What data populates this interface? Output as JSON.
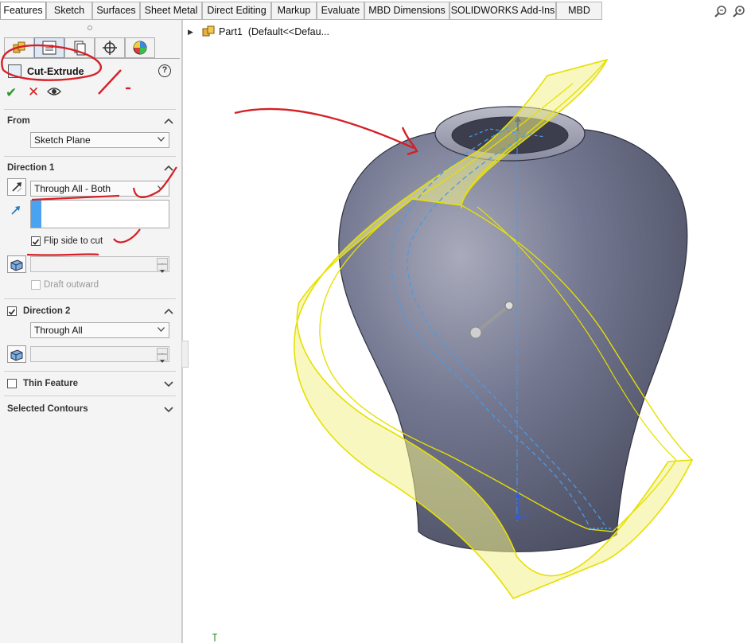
{
  "tabs": [
    {
      "label": "Features",
      "active": true
    },
    {
      "label": "Sketch"
    },
    {
      "label": "Surfaces"
    },
    {
      "label": "Sheet Metal"
    },
    {
      "label": "Direct Editing"
    },
    {
      "label": "Markup"
    },
    {
      "label": "Evaluate"
    },
    {
      "label": "MBD Dimensions"
    },
    {
      "label": "SOLIDWORKS Add-Ins"
    },
    {
      "label": "MBD"
    }
  ],
  "property_manager": {
    "title": "Cut-Extrude",
    "help_symbol": "?",
    "ok_symbol": "✔",
    "cancel_symbol": "✕",
    "from": {
      "label": "From",
      "value": "Sketch Plane"
    },
    "direction1": {
      "label": "Direction 1",
      "end_condition": "Through All - Both",
      "flip_side_label": "Flip side to cut",
      "flip_side_checked": true,
      "draft_outward_label": "Draft outward",
      "draft_outward_checked": false
    },
    "direction2": {
      "label": "Direction 2",
      "checked": true,
      "end_condition": "Through All"
    },
    "thin_feature": {
      "label": "Thin Feature",
      "checked": false
    },
    "selected_contours": {
      "label": "Selected Contours"
    }
  },
  "feature_tree": {
    "part_label": "Part1",
    "config_label": "(Default<<Defau..."
  },
  "colors": {
    "accent_blue": "#4aa3f0",
    "body_gray": "#6e7188",
    "preview_yellow": "#f2f08a",
    "annotation_red": "#d61f26"
  }
}
